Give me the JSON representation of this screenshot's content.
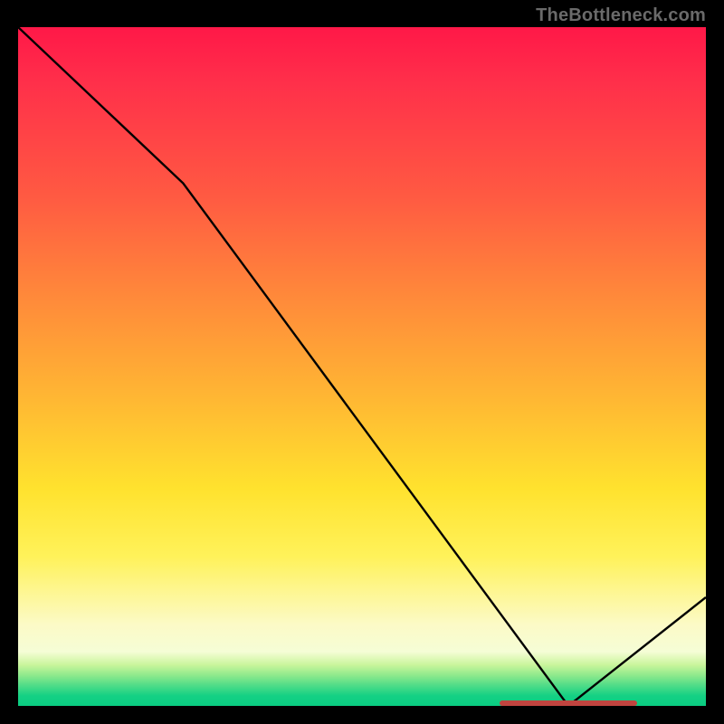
{
  "watermark": "TheBottleneck.com",
  "chart_data": {
    "type": "line",
    "title": "",
    "xlabel": "",
    "ylabel": "",
    "xlim": [
      0,
      100
    ],
    "ylim": [
      0,
      100
    ],
    "grid": false,
    "legend_position": "none",
    "series": [
      {
        "name": "curve",
        "x": [
          0,
          24,
          80,
          100
        ],
        "y": [
          100,
          77,
          0,
          16
        ],
        "color": "#000000"
      }
    ],
    "highlight_band": {
      "x_start": 70,
      "x_end": 90,
      "y": 0.4,
      "color": "#c0443f",
      "label": ""
    },
    "background_gradient": {
      "stops": [
        {
          "pos": 0,
          "color": "#ff1848"
        },
        {
          "pos": 25,
          "color": "#ff5a42"
        },
        {
          "pos": 55,
          "color": "#ffb833"
        },
        {
          "pos": 78,
          "color": "#fff25a"
        },
        {
          "pos": 92,
          "color": "#f5fdd6"
        },
        {
          "pos": 97,
          "color": "#4fdc88"
        },
        {
          "pos": 100,
          "color": "#0acc82"
        }
      ]
    }
  }
}
